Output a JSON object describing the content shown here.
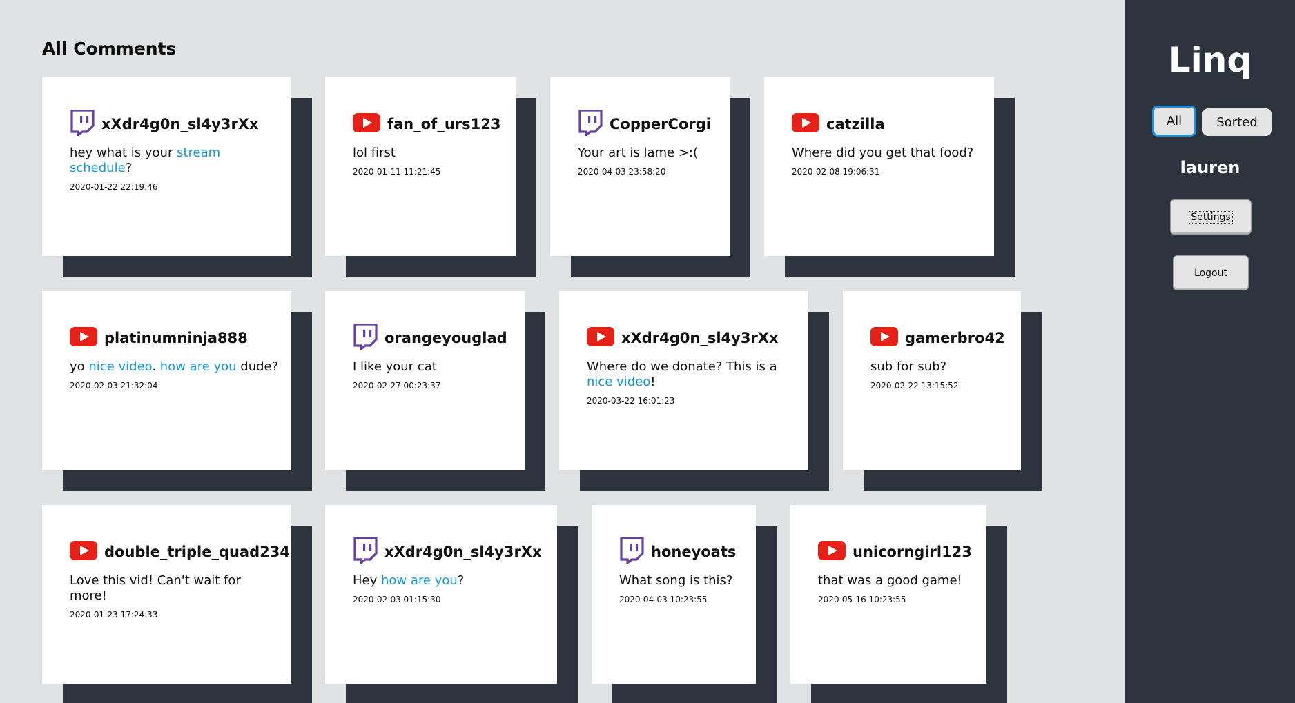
{
  "page": {
    "heading": "All Comments"
  },
  "sidebar": {
    "logo": "Linq",
    "filter": {
      "all_label": "All",
      "sorted_label": "Sorted"
    },
    "username": "lauren",
    "settings_label": "Settings",
    "logout_label": "Logout"
  },
  "comments": [
    {
      "platform": "twitch",
      "user": "xXdr4g0n_sl4y3rXx",
      "text_parts": [
        {
          "t": "hey what is your "
        },
        {
          "t": "stream schedule",
          "link": true
        },
        {
          "t": "?"
        }
      ],
      "time": "2020-01-22 22:19:46"
    },
    {
      "platform": "youtube",
      "user": "fan_of_urs123",
      "text_parts": [
        {
          "t": "lol first"
        }
      ],
      "time": "2020-01-11 11:21:45"
    },
    {
      "platform": "twitch",
      "user": "CopperCorgi",
      "text_parts": [
        {
          "t": "Your art is lame >:("
        }
      ],
      "time": "2020-04-03 23:58:20"
    },
    {
      "platform": "youtube",
      "user": "catzilla",
      "text_parts": [
        {
          "t": "Where did you get that food?"
        }
      ],
      "time": "2020-02-08 19:06:31"
    },
    {
      "platform": "youtube",
      "user": "platinumninja888",
      "text_parts": [
        {
          "t": "yo "
        },
        {
          "t": "nice video",
          "link": true
        },
        {
          "t": ". "
        },
        {
          "t": "how are you",
          "link": true
        },
        {
          "t": " dude?"
        }
      ],
      "time": "2020-02-03 21:32:04"
    },
    {
      "platform": "twitch",
      "user": "orangeyouglad",
      "text_parts": [
        {
          "t": "I like your cat"
        }
      ],
      "time": "2020-02-27 00:23:37"
    },
    {
      "platform": "youtube",
      "user": "xXdr4g0n_sl4y3rXx",
      "text_parts": [
        {
          "t": "Where do we donate? This is a "
        },
        {
          "t": "nice video",
          "link": true
        },
        {
          "t": "!"
        }
      ],
      "time": "2020-03-22 16:01:23"
    },
    {
      "platform": "youtube",
      "user": "gamerbro42",
      "text_parts": [
        {
          "t": "sub for sub?"
        }
      ],
      "time": "2020-02-22 13:15:52"
    },
    {
      "platform": "youtube",
      "user": "double_triple_quad234",
      "text_parts": [
        {
          "t": "Love this vid! Can't wait for more!"
        }
      ],
      "time": "2020-01-23 17:24:33"
    },
    {
      "platform": "twitch",
      "user": "xXdr4g0n_sl4y3rXx",
      "text_parts": [
        {
          "t": "Hey "
        },
        {
          "t": "how are you",
          "link": true
        },
        {
          "t": "?"
        }
      ],
      "time": "2020-02-03 01:15:30"
    },
    {
      "platform": "twitch",
      "user": "honeyoats",
      "text_parts": [
        {
          "t": "What song is this?"
        }
      ],
      "time": "2020-04-03 10:23:55"
    },
    {
      "platform": "youtube",
      "user": "unicorngirl123",
      "text_parts": [
        {
          "t": "that was a good game!"
        }
      ],
      "time": "2020-05-16 10:23:55"
    }
  ],
  "icons": {
    "twitch": {
      "name": "twitch-icon",
      "color": "#6441a5"
    },
    "youtube": {
      "name": "youtube-icon",
      "color": "#e62117"
    }
  },
  "colors": {
    "link": "#0f97e0",
    "sidebar": "#2e343d",
    "background": "#e1e2e4",
    "active_toggle_border": "#1d8fe0"
  }
}
